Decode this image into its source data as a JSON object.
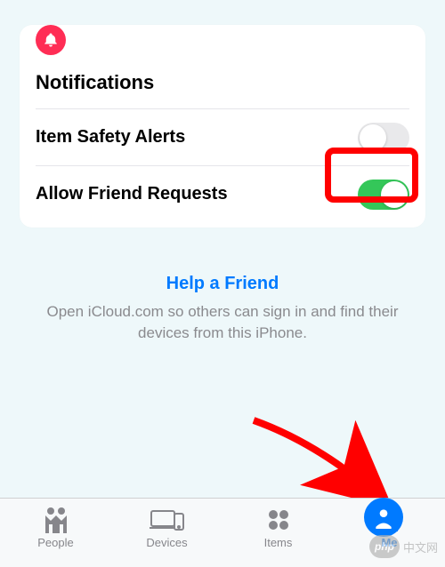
{
  "card": {
    "title": "Notifications",
    "rows": [
      {
        "label": "Item Safety Alerts",
        "state": "off",
        "highlighted": true
      },
      {
        "label": "Allow Friend Requests",
        "state": "on",
        "highlighted": false
      }
    ]
  },
  "help": {
    "link": "Help a Friend",
    "description": "Open iCloud.com so others can sign in and find their devices from this iPhone."
  },
  "tabs": [
    {
      "label": "People",
      "active": false
    },
    {
      "label": "Devices",
      "active": false
    },
    {
      "label": "Items",
      "active": false
    },
    {
      "label": "Me",
      "active": true
    }
  ],
  "watermark": {
    "badge": "php",
    "text": "中文网"
  },
  "colors": {
    "accent": "#007aff",
    "alert": "#ff2d55",
    "toggle_on": "#34c759",
    "highlight": "#ff0000"
  }
}
